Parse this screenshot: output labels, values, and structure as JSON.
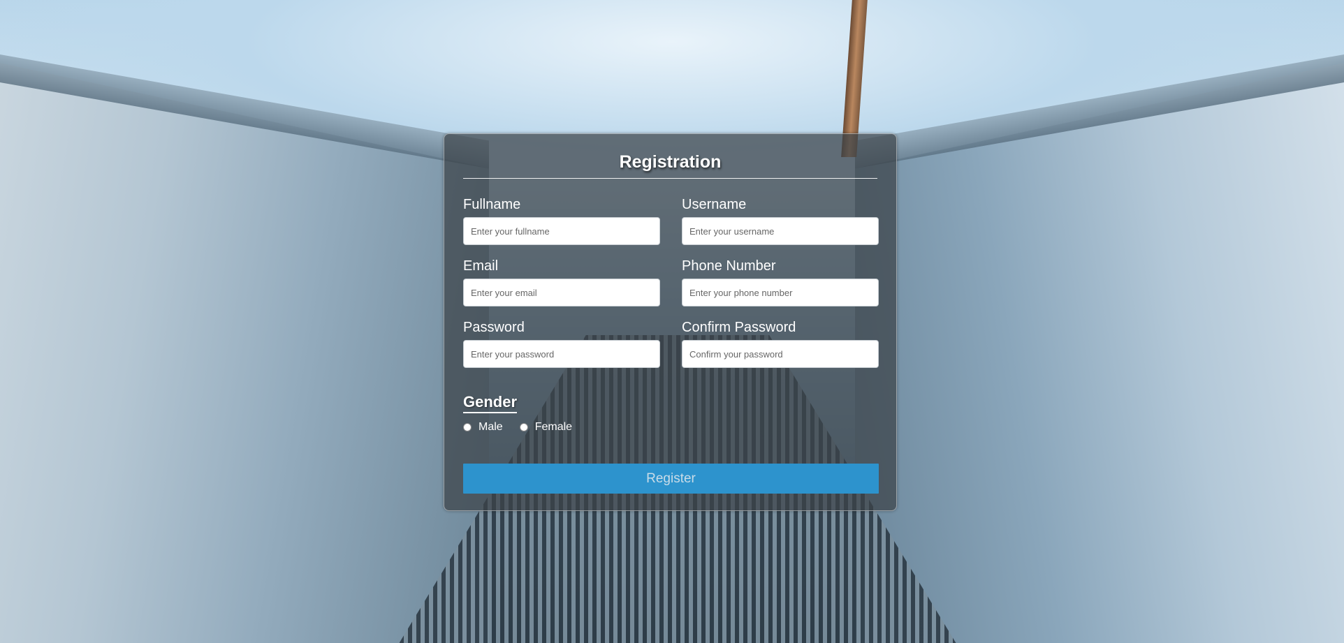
{
  "form": {
    "title": "Registration",
    "fields": [
      {
        "label": "Fullname",
        "placeholder": "Enter your fullname",
        "value": ""
      },
      {
        "label": "Username",
        "placeholder": "Enter your username",
        "value": ""
      },
      {
        "label": "Email",
        "placeholder": "Enter your email",
        "value": ""
      },
      {
        "label": "Phone Number",
        "placeholder": "Enter your phone number",
        "value": ""
      },
      {
        "label": "Password",
        "placeholder": "Enter your password",
        "value": ""
      },
      {
        "label": "Confirm Password",
        "placeholder": "Confirm your password",
        "value": ""
      }
    ],
    "gender": {
      "title": "Gender",
      "options": [
        {
          "label": "Male",
          "selected": false
        },
        {
          "label": "Female",
          "selected": false
        }
      ]
    },
    "submit_label": "Register"
  },
  "colors": {
    "button": "#2d93cd",
    "card_overlay": "#3c4248"
  },
  "icons": [
    "radio-unchecked-icon"
  ]
}
